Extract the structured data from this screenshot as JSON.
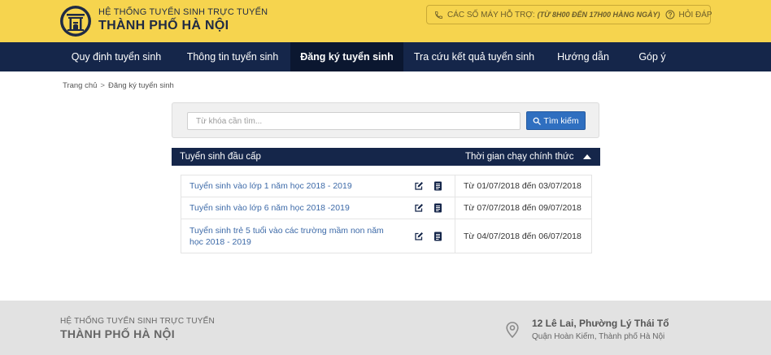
{
  "header": {
    "brand_line1": "HỆ THỐNG TUYỂN SINH TRỰC TUYẾN",
    "brand_line2": "THÀNH PHỐ HÀ NỘI",
    "support_label": "CÁC SỐ MÁY HỖ TRỢ:",
    "support_hours": "(TỪ 8H00 ĐẾN 17H00 HÀNG NGÀY)",
    "faq_label": "HỎI ĐÁP",
    "logo_icon": "hanoi-emblem-logo",
    "phone_icon": "phone-icon",
    "help_icon": "question-circle-icon"
  },
  "nav": {
    "items": [
      {
        "label": "Quy định tuyển sinh"
      },
      {
        "label": "Thông tin tuyển sinh"
      },
      {
        "label": "Đăng ký tuyển sinh"
      },
      {
        "label": "Tra cứu kết quả tuyển sinh"
      },
      {
        "label": "Hướng dẫn"
      },
      {
        "label": "Góp ý"
      }
    ],
    "active_index": 2
  },
  "breadcrumb": {
    "home": "Trang chủ",
    "separator": ">",
    "current": "Đăng ký tuyển sinh"
  },
  "search": {
    "placeholder": "Từ khóa cần tìm...",
    "value": "",
    "button_label": "Tìm kiếm",
    "icon": "search-icon"
  },
  "table": {
    "header_left": "Tuyển sinh đầu cấp",
    "header_right": "Thời gian chạy chính thức",
    "rows": [
      {
        "name": "Tuyển sinh vào lớp 1 năm học 2018 - 2019",
        "period": "Từ 01/07/2018 đến 03/07/2018"
      },
      {
        "name": "Tuyển sinh vào lớp 6 năm học 2018 -2019",
        "period": "Từ 07/07/2018 đến 09/07/2018"
      },
      {
        "name": "Tuyển sinh trẻ 5 tuổi vào các trường mầm non năm học 2018 - 2019",
        "period": "Từ 04/07/2018 đến 06/07/2018"
      }
    ],
    "row_icons": [
      "edit-icon",
      "document-icon"
    ]
  },
  "footer": {
    "line1": "HỆ THỐNG TUYỂN SINH TRỰC TUYẾN",
    "line2": "THÀNH PHỐ HÀ NỘI",
    "address1": "12 Lê Lai, Phường Lý Thái Tổ",
    "address2": "Quận Hoàn Kiếm, Thành phố Hà Nội",
    "pin_icon": "map-pin-icon"
  },
  "colors": {
    "header_bg": "#f6d44e",
    "nav_bg": "#15264a",
    "nav_active_bg": "#0b1730",
    "link": "#3d6aa8",
    "button": "#2f6fc0",
    "footer_bg": "#e2e2e2"
  }
}
